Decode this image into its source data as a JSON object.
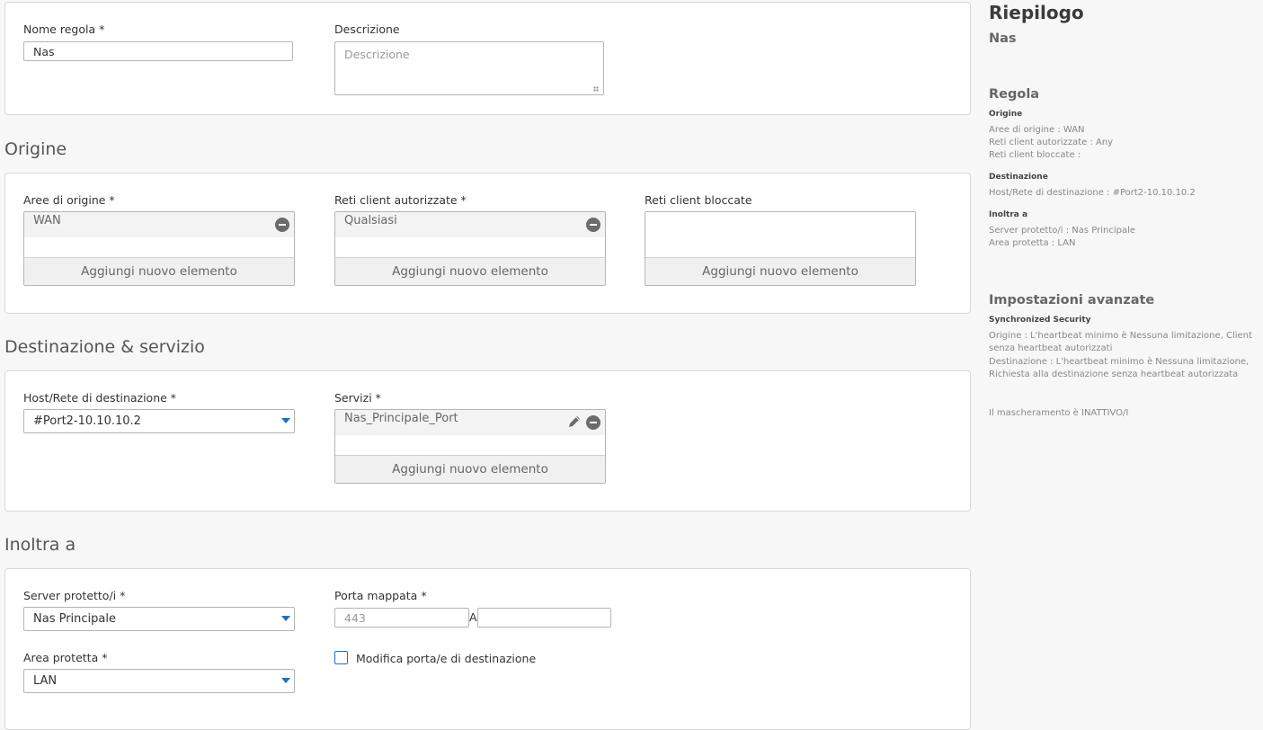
{
  "rule": {
    "name_label": "Nome regola *",
    "name_value": "Nas",
    "desc_label": "Descrizione",
    "desc_placeholder": "Descrizione"
  },
  "origin": {
    "title": "Origine",
    "zones_label": "Aree di origine *",
    "zones_item": "WAN",
    "allowed_label": "Reti client autorizzate *",
    "allowed_item": "Qualsiasi",
    "blocked_label": "Reti client bloccate",
    "add_label": "Aggiungi nuovo elemento"
  },
  "destination": {
    "title": "Destinazione & servizio",
    "host_label": "Host/Rete di destinazione *",
    "host_value": "#Port2-10.10.10.2",
    "services_label": "Servizi *",
    "services_item": "Nas_Principale_Port",
    "add_label": "Aggiungi nuovo elemento"
  },
  "forward": {
    "title": "Inoltra a",
    "server_label": "Server protetto/i *",
    "server_value": "Nas Principale",
    "port_label": "Porta mappata *",
    "port_placeholder": "443",
    "port_separator": "A",
    "port_to_value": "",
    "zone_label": "Area protetta *",
    "zone_value": "LAN",
    "modify_port_label": "Modifica porta/e di destinazione",
    "modify_port_checked": false
  },
  "summary": {
    "title": "Riepilogo",
    "rule_name": "Nas",
    "rule_heading": "Regola",
    "origin_heading": "Origine",
    "origin_lines": [
      "Aree di origine : WAN",
      "Reti client autorizzate : Any",
      "Reti client bloccate :"
    ],
    "dest_heading": "Destinazione",
    "dest_lines": [
      "Host/Rete di destinazione : #Port2-10.10.10.2"
    ],
    "forward_heading": "Inoltra a",
    "forward_lines": [
      "Server protetto/i : Nas Principale",
      "Area protetta : LAN"
    ],
    "advanced_heading": "Impostazioni avanzate",
    "sync_heading": "Synchronized Security",
    "sync_lines": [
      "Origine : L'heartbeat minimo è Nessuna limitazione, Client",
      "senza heartbeat autorizzati",
      "Destinazione : L'heartbeat minimo è Nessuna limitazione,",
      "Richiesta alla destinazione senza heartbeat autorizzata"
    ],
    "masquerade_line": "Il mascheramento è INATTIVO/I"
  },
  "colors": {
    "accent": "#1f6fbf",
    "page_bg": "#f7f7f7",
    "card_border": "#d8d8d8"
  },
  "icons": {
    "remove": "minus-circle-icon",
    "edit": "pencil-icon",
    "dropdown": "chevron-down-icon"
  }
}
